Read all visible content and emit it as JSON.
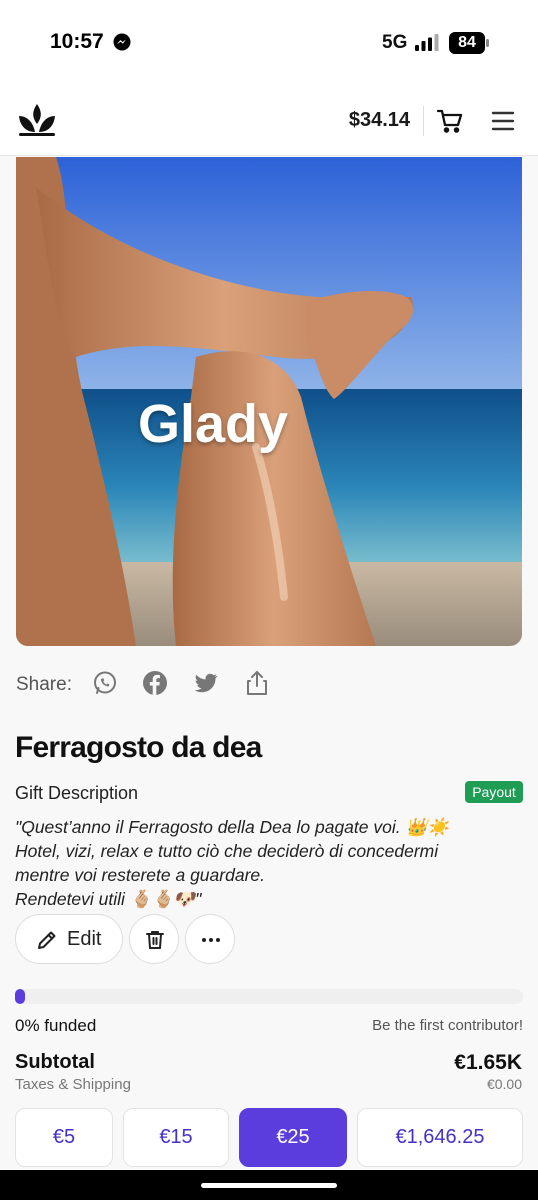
{
  "status_bar": {
    "time": "10:57",
    "network": "5G",
    "battery": "84"
  },
  "header": {
    "balance": "$34.14",
    "logo_icon": "crown-logo-icon",
    "cart_icon": "cart-icon",
    "menu_icon": "hamburger-menu-icon"
  },
  "hero": {
    "caption": "Glady"
  },
  "share": {
    "label": "Share:",
    "icons": [
      "whatsapp-icon",
      "facebook-icon",
      "twitter-icon",
      "share-upload-icon"
    ]
  },
  "gift": {
    "title": "Ferragosto da dea",
    "description_label": "Gift Description",
    "badge": "Payout",
    "description_lines": [
      "\"Quest’anno il Ferragosto della Dea lo pagate voi. 👑☀️",
      "Hotel, vizi, relax e tutto ciò che deciderò di concedermi",
      "mentre voi resterete a guardare.",
      "Rendetevi utili 🫰🏼🫰🏼🐶\""
    ]
  },
  "actions": {
    "edit_label": "Edit",
    "delete_icon": "trash-icon",
    "more_icon": "more-dots-icon"
  },
  "funding": {
    "progress_fraction": 0.0,
    "funded_label": "0% funded",
    "first_contributor": "Be the first contributor!",
    "subtotal_label": "Subtotal",
    "subtotal_value": "€1.65K",
    "taxes_label": "Taxes & Shipping",
    "taxes_value": "€0.00"
  },
  "amounts": [
    {
      "label": "€5",
      "selected": false
    },
    {
      "label": "€15",
      "selected": false
    },
    {
      "label": "€25",
      "selected": true
    },
    {
      "label": "€1,646.25",
      "selected": false
    }
  ],
  "colors": {
    "accent": "#5a3ddc",
    "accent_text": "#4432c6",
    "payout_badge": "#1f9d55"
  }
}
